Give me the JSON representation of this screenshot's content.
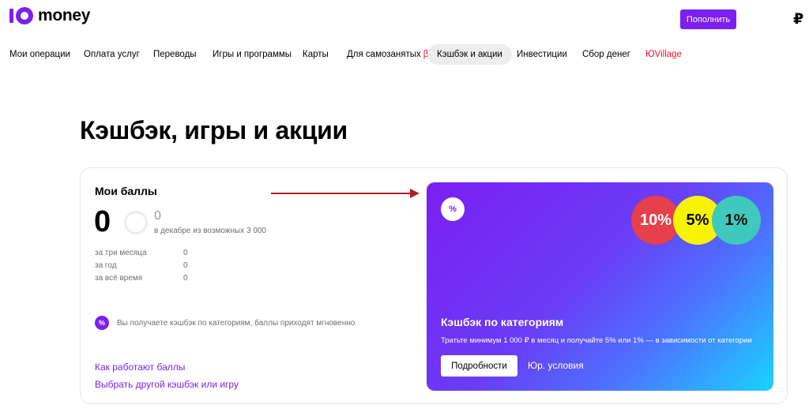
{
  "header": {
    "logo_text": "money",
    "topup_label": "Пополнить",
    "currency_symbol": "₽"
  },
  "nav": {
    "items": [
      {
        "label": "Мои операции"
      },
      {
        "label": "Оплата услуг"
      },
      {
        "label": "Переводы"
      },
      {
        "label": "Игры и программы"
      },
      {
        "label": "Карты"
      },
      {
        "label": "Для самозанятых",
        "badge": "β"
      },
      {
        "label": "Кэшбэк и акции",
        "active": true
      },
      {
        "label": "Инвестиции"
      },
      {
        "label": "Сбор денег"
      },
      {
        "label": "ЮVillage",
        "color": "#f0172c"
      }
    ]
  },
  "page": {
    "title": "Кэшбэк, игры и акции"
  },
  "points": {
    "title": "Мои баллы",
    "value": "0",
    "month_value": "0",
    "month_caption": "в декабре из возможных 3 000",
    "stats": [
      {
        "label": "за три месяца",
        "value": "0"
      },
      {
        "label": "за год",
        "value": "0"
      },
      {
        "label": "за всё время",
        "value": "0"
      }
    ],
    "info_icon": "%",
    "info_text": "Вы получаете кэшбэк по категориям, баллы приходят мгновенно",
    "links": [
      {
        "label": "Как работают баллы"
      },
      {
        "label": "Выбрать другой кэшбэк или игру"
      }
    ]
  },
  "promo": {
    "badge_icon": "%",
    "percents": [
      "10%",
      "5%",
      "1%"
    ],
    "title": "Кэшбэк по категориям",
    "description": "Тратьте минимум 1 000 ₽ в месяц и получайте 5% или 1% — в зависимости от категории",
    "details_label": "Подробности",
    "terms_label": "Юр. условия"
  },
  "colors": {
    "accent": "#7b1ff2",
    "red": "#f0172c",
    "arrow": "#b01d22"
  }
}
